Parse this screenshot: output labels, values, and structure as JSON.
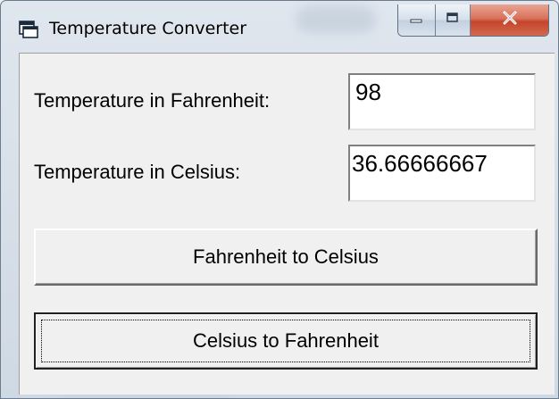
{
  "window": {
    "title": "Temperature Converter",
    "app_icon": "window-app-icon",
    "caption_buttons": {
      "minimize_icon": "minimize-icon",
      "maximize_icon": "maximize-icon",
      "close_icon": "close-icon"
    }
  },
  "form": {
    "fahrenheit_label": "Temperature in Fahrenheit:",
    "fahrenheit_value": "98",
    "celsius_label": "Temperature in Celsius:",
    "celsius_value": "36.66666667",
    "f_to_c_button": "Fahrenheit to Celsius",
    "c_to_f_button": "Celsius to Fahrenheit"
  },
  "colors": {
    "close_button": "#c5452c",
    "client_background": "#f0f0f0",
    "frame": "#cfd9e4"
  }
}
